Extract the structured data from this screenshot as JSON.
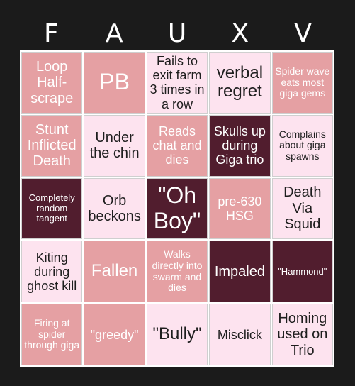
{
  "header": {
    "letters": [
      "F",
      "A",
      "U",
      "X",
      "V"
    ]
  },
  "colors": {
    "background": "#1b1b1b",
    "mid": "#e5a0a3",
    "light": "#fde3ef",
    "dark": "#511d2e"
  },
  "board": {
    "cells": [
      {
        "text": "Loop Half-scrape",
        "style": "mid"
      },
      {
        "text": "PB",
        "style": "mid"
      },
      {
        "text": "Fails to exit farm 3 times in a row",
        "style": "light"
      },
      {
        "text": "verbal regret",
        "style": "light"
      },
      {
        "text": "Spider wave eats most giga gems",
        "style": "mid"
      },
      {
        "text": "Stunt Inflicted Death",
        "style": "mid"
      },
      {
        "text": "Under the chin",
        "style": "light"
      },
      {
        "text": "Reads chat and dies",
        "style": "mid"
      },
      {
        "text": "Skulls up during Giga trio",
        "style": "dark"
      },
      {
        "text": "Complains about giga spawns",
        "style": "light"
      },
      {
        "text": "Completely random tangent",
        "style": "dark"
      },
      {
        "text": "Orb beckons",
        "style": "light"
      },
      {
        "text": "\"Oh Boy\"",
        "style": "dark"
      },
      {
        "text": "pre-630 HSG",
        "style": "mid"
      },
      {
        "text": "Death Via Squid",
        "style": "light"
      },
      {
        "text": "Kiting during ghost kill",
        "style": "light"
      },
      {
        "text": "Fallen",
        "style": "mid"
      },
      {
        "text": "Walks directly into swarm and dies",
        "style": "mid"
      },
      {
        "text": "Impaled",
        "style": "dark"
      },
      {
        "text": "\"Hammond\"",
        "style": "dark"
      },
      {
        "text": "Firing at spider through giga",
        "style": "mid"
      },
      {
        "text": "\"greedy\"",
        "style": "mid"
      },
      {
        "text": "\"Bully\"",
        "style": "light"
      },
      {
        "text": "Misclick",
        "style": "light"
      },
      {
        "text": "Homing used on Trio",
        "style": "light"
      }
    ]
  }
}
